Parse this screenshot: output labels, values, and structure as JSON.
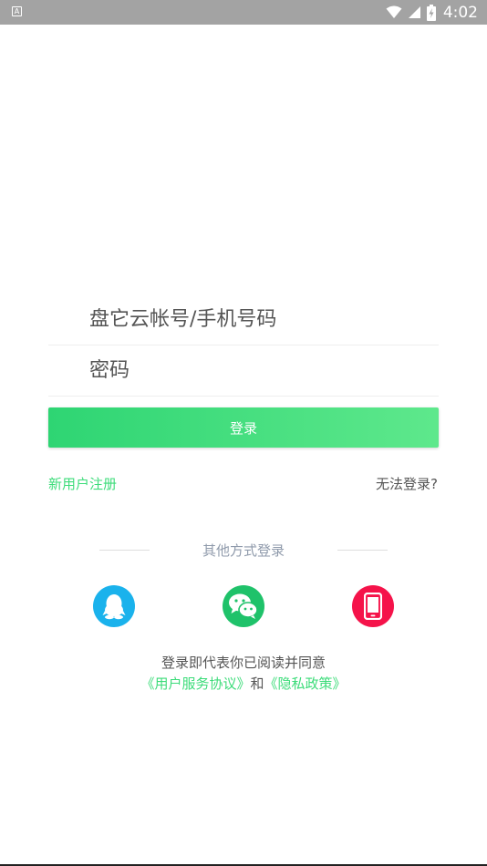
{
  "status_bar": {
    "app_badge": "A",
    "time": "4:02"
  },
  "login_form": {
    "account_placeholder": "盘它云帐号/手机号码",
    "password_placeholder": "密码",
    "login_button": "登录"
  },
  "links": {
    "register": "新用户注册",
    "cant_login": "无法登录?"
  },
  "other_login": {
    "label": "其他方式登录",
    "methods": [
      {
        "name": "qq",
        "icon": "qq-penguin-icon",
        "color": "#1ab2ec"
      },
      {
        "name": "wechat",
        "icon": "wechat-icon",
        "color": "#1fc26a"
      },
      {
        "name": "phone",
        "icon": "mobile-phone-icon",
        "color": "#f5134a"
      }
    ]
  },
  "agreement": {
    "line1": "登录即代表你已阅读并同意",
    "user_agreement": "《用户服务协议》",
    "and": "和",
    "privacy_policy": "《隐私政策》"
  },
  "colors": {
    "accent_green": "#3ddc7a",
    "status_bar_bg": "#a3a3a3"
  }
}
